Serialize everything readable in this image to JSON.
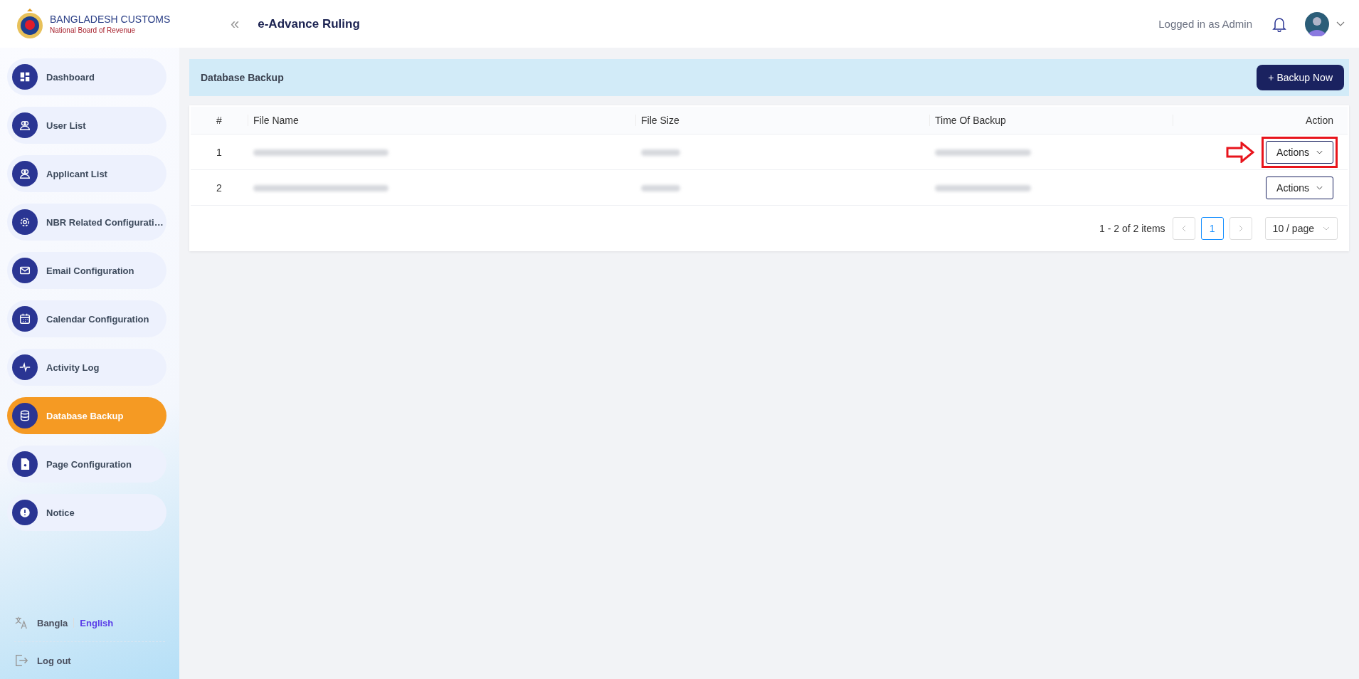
{
  "header": {
    "brand_title": "BANGLADESH CUSTOMS",
    "brand_subtitle": "National Board of Revenue",
    "collapse_glyph": "«",
    "app_title": "e-Advance Ruling",
    "user_label": "Logged in as Admin"
  },
  "sidebar": {
    "items": [
      {
        "label": "Dashboard",
        "selected": false
      },
      {
        "label": "User List",
        "selected": false
      },
      {
        "label": "Applicant List",
        "selected": false
      },
      {
        "label": "NBR Related Configurati…",
        "selected": false
      },
      {
        "label": "Email Configuration",
        "selected": false
      },
      {
        "label": "Calendar Configuration",
        "selected": false
      },
      {
        "label": "Activity Log",
        "selected": false
      },
      {
        "label": "Database Backup",
        "selected": true
      },
      {
        "label": "Page Configuration",
        "selected": false
      },
      {
        "label": "Notice",
        "selected": false
      }
    ],
    "languages": [
      {
        "label": "Bangla",
        "selected": false
      },
      {
        "label": "English",
        "selected": true
      }
    ],
    "logout": "Log out"
  },
  "page": {
    "title": "Database Backup",
    "backup_button": "+ Backup Now"
  },
  "table": {
    "columns": [
      "#",
      "File Name",
      "File Size",
      "Time Of Backup",
      "Action"
    ],
    "rows": [
      {
        "index": "1",
        "action": "Actions",
        "highlighted": true
      },
      {
        "index": "2",
        "action": "Actions",
        "highlighted": false
      }
    ]
  },
  "pagination": {
    "summary": "1 - 2 of 2 items",
    "pages": [
      {
        "label": "1",
        "selected": true
      }
    ],
    "page_size": "10 / page"
  }
}
